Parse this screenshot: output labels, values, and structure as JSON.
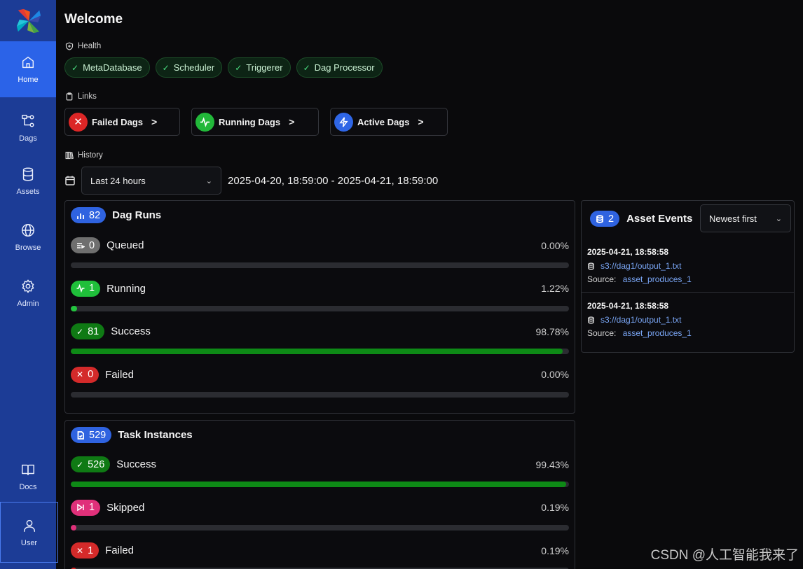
{
  "sidebar": {
    "items": [
      {
        "label": "Home",
        "icon": "home-icon"
      },
      {
        "label": "Dags",
        "icon": "dags-icon"
      },
      {
        "label": "Assets",
        "icon": "database-icon"
      },
      {
        "label": "Browse",
        "icon": "globe-icon"
      },
      {
        "label": "Admin",
        "icon": "gear-icon"
      },
      {
        "label": "Docs",
        "icon": "book-icon"
      },
      {
        "label": "User",
        "icon": "user-icon"
      }
    ],
    "active": "Home",
    "color": "#1c3c96",
    "active_color": "#2b63e8"
  },
  "page_title": "Welcome",
  "health": {
    "label": "Health",
    "items": [
      "MetaDatabase",
      "Scheduler",
      "Triggerer",
      "Dag Processor"
    ]
  },
  "links": {
    "label": "Links",
    "failed": "Failed Dags",
    "running": "Running Dags",
    "active": "Active Dags"
  },
  "history": {
    "label": "History",
    "range_select": "Last 24 hours",
    "range_text": "2025-04-20, 18:59:00 - 2025-04-21, 18:59:00"
  },
  "dag_runs": {
    "count": "82",
    "title": "Dag Runs",
    "states": [
      {
        "name": "Queued",
        "count": "0",
        "pct": "0.00%",
        "fraction": 0.0,
        "color": "#6f6f6f",
        "fill_color": "#6f6f6f",
        "icon": "queue-icon"
      },
      {
        "name": "Running",
        "count": "1",
        "pct": "1.22%",
        "fraction": 0.0122,
        "color": "#1fbf3a",
        "fill_color": "#23c43f",
        "icon": "pulse-icon"
      },
      {
        "name": "Success",
        "count": "81",
        "pct": "98.78%",
        "fraction": 0.9878,
        "color": "#0f7a14",
        "fill_color": "#0e8a16",
        "icon": "check-icon"
      },
      {
        "name": "Failed",
        "count": "0",
        "pct": "0.00%",
        "fraction": 0.0,
        "color": "#d42a2a",
        "fill_color": "#d42a2a",
        "icon": "x-icon"
      }
    ]
  },
  "task_instances": {
    "count": "529",
    "title": "Task Instances",
    "states": [
      {
        "name": "Success",
        "count": "526",
        "pct": "99.43%",
        "fraction": 0.9943,
        "color": "#0f7a14",
        "fill_color": "#0e8a16",
        "icon": "check-icon"
      },
      {
        "name": "Skipped",
        "count": "1",
        "pct": "0.19%",
        "fraction": 0.0019,
        "color": "#e0307a",
        "fill_color": "#e0307a",
        "icon": "skip-icon"
      },
      {
        "name": "Failed",
        "count": "1",
        "pct": "0.19%",
        "fraction": 0.0019,
        "color": "#d42a2a",
        "fill_color": "#d42a2a",
        "icon": "x-icon"
      }
    ]
  },
  "asset_events": {
    "count": "2",
    "title": "Asset Events",
    "sort": "Newest first",
    "events": [
      {
        "time": "2025-04-21, 18:58:58",
        "uri": "s3://dag1/output_1.txt",
        "source_label": "Source:",
        "source": "asset_produces_1"
      },
      {
        "time": "2025-04-21, 18:58:58",
        "uri": "s3://dag1/output_1.txt",
        "source_label": "Source:",
        "source": "asset_produces_1"
      }
    ]
  },
  "watermark": "CSDN @人工智能我来了"
}
